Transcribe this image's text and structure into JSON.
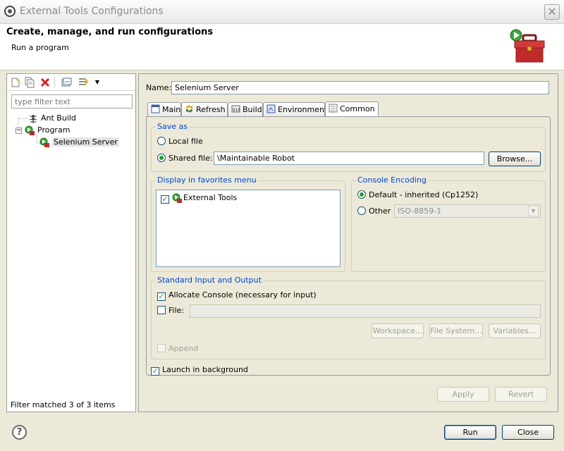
{
  "window": {
    "title": "External Tools Configurations",
    "close_glyph": "✕"
  },
  "header": {
    "title": "Create, manage, and run configurations",
    "subtitle": "Run a program"
  },
  "left_pane": {
    "toolbar_icons": [
      "new-config-icon",
      "duplicate-icon",
      "delete-icon",
      "collapse-all-icon",
      "filter-icon",
      "dropdown-arrow-icon"
    ],
    "filter_placeholder": "type filter text",
    "tree": [
      {
        "label": "Ant Build",
        "icon": "ant-icon",
        "level": 1,
        "selected": false
      },
      {
        "label": "Program",
        "icon": "program-icon",
        "level": 0,
        "expanded": true,
        "selected": false
      },
      {
        "label": "Selenium Server",
        "icon": "program-icon",
        "level": 2,
        "selected": true
      }
    ],
    "status": "Filter matched 3 of 3 items"
  },
  "right_pane": {
    "name_label": "Name:",
    "name_value": "Selenium Server",
    "tabs": [
      {
        "label": "Main",
        "icon": "main-tab-icon",
        "active": false
      },
      {
        "label": "Refresh",
        "icon": "refresh-icon",
        "active": false
      },
      {
        "label": "Build",
        "icon": "build-icon",
        "active": false
      },
      {
        "label": "Environment",
        "icon": "environment-icon",
        "active": false
      },
      {
        "label": "Common",
        "icon": "common-icon",
        "active": true
      }
    ],
    "save_as": {
      "title": "Save as",
      "local_file_label": "Local file",
      "shared_file_label": "Shared file:",
      "selected": "shared",
      "shared_file_value": "\\Maintainable Robot",
      "browse_label": "Browse..."
    },
    "favorites": {
      "title": "Display in favorites menu",
      "items": [
        {
          "label": "External Tools",
          "checked": true
        }
      ]
    },
    "console_encoding": {
      "title": "Console Encoding",
      "default_label": "Default - inherited (Cp1252)",
      "other_label": "Other",
      "selected": "default",
      "other_value": "ISO-8859-1"
    },
    "std_io": {
      "title": "Standard Input and Output",
      "allocate_console_label": "Allocate Console (necessary for input)",
      "allocate_console_checked": true,
      "file_label": "File:",
      "file_checked": false,
      "file_value": "",
      "workspace_label": "Workspace...",
      "filesystem_label": "File System...",
      "variables_label": "Variables...",
      "append_label": "Append",
      "append_checked": false
    },
    "launch_background_label": "Launch in background",
    "launch_background_checked": true,
    "apply_label": "Apply",
    "revert_label": "Revert"
  },
  "footer": {
    "help_glyph": "?",
    "run_label": "Run",
    "close_label": "Close"
  },
  "colors": {
    "group_title": "#0046d5",
    "dialog_bg": "#ece9d8",
    "check_mark": "#21a121"
  }
}
